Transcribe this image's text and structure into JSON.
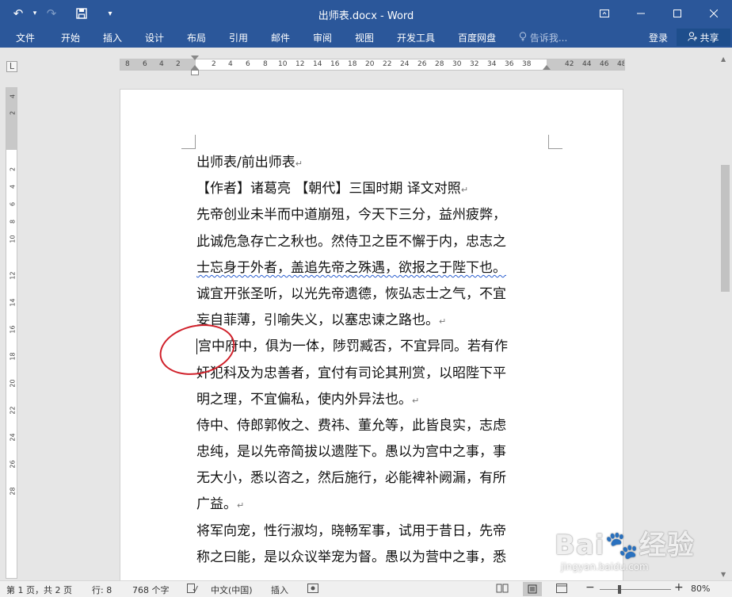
{
  "window": {
    "title": "出师表.docx - Word",
    "controls": [
      "ribbon-display-icon",
      "minimize-icon",
      "maximize-icon",
      "close-icon"
    ]
  },
  "qat": {
    "undo": "↶",
    "undo_drop": "▾",
    "redo": "↷",
    "save": "🖫",
    "customize": "▾"
  },
  "ribbon": {
    "tabs": [
      "文件",
      "开始",
      "插入",
      "设计",
      "布局",
      "引用",
      "邮件",
      "审阅",
      "视图",
      "开发工具",
      "百度网盘"
    ],
    "tellme": "告诉我...",
    "login": "登录",
    "share": "共享"
  },
  "ruler": {
    "corner": "L",
    "h_numbers": [
      "8",
      "6",
      "4",
      "2",
      "2",
      "4",
      "6",
      "8",
      "10",
      "12",
      "14",
      "16",
      "18",
      "20",
      "22",
      "24",
      "26",
      "28",
      "30",
      "32",
      "34",
      "36",
      "38",
      "42",
      "44",
      "46",
      "48"
    ],
    "v_numbers": [
      "4",
      "2",
      "2",
      "4",
      "6",
      "8",
      "10",
      "12",
      "14",
      "16",
      "18",
      "20",
      "22",
      "24",
      "26",
      "28"
    ]
  },
  "document": {
    "lines": [
      {
        "text": "出师表/前出师表",
        "mark": "↵"
      },
      {
        "text": "【作者】诸葛亮 【朝代】三国时期 译文对照",
        "mark": "↵"
      },
      {
        "text": "先帝创业未半而中道崩殂，今天下三分，益州疲弊，",
        "mark": ""
      },
      {
        "text": "此诚危急存亡之秋也。然侍卫之臣不懈于内，忠志之",
        "mark": ""
      },
      {
        "text": "士忘身于外者，盖追先帝之殊遇，欲报之于陛下也。",
        "mark": ""
      },
      {
        "text": "诚宜开张圣听，以光先帝遗德，恢弘志士之气，不宜",
        "mark": ""
      },
      {
        "text": "妄自菲薄，引喻失义，以塞忠谏之路也。",
        "mark": "↵"
      },
      {
        "text": "宫中府中，俱为一体，陟罚臧否，不宜异同。若有作",
        "mark": ""
      },
      {
        "text": "奸犯科及为忠善者，宜付有司论其刑赏，以昭陛下平",
        "mark": ""
      },
      {
        "text": "明之理，不宜偏私，使内外异法也。",
        "mark": "↵"
      },
      {
        "text": "侍中、侍郎郭攸之、费祎、董允等，此皆良实，志虑",
        "mark": ""
      },
      {
        "text": "忠纯，是以先帝简拔以遗陛下。愚以为宫中之事，事",
        "mark": ""
      },
      {
        "text": "无大小，悉以咨之，然后施行，必能裨补阙漏，有所",
        "mark": ""
      },
      {
        "text": "广益。",
        "mark": "↵"
      },
      {
        "text": "将军向宠，性行淑均，晓畅军事，试用于昔日，先帝",
        "mark": ""
      },
      {
        "text": "称之曰能，是以众议举宠为督。愚以为营中之事，悉",
        "mark": ""
      }
    ]
  },
  "status": {
    "page": "第 1 页，共 2 页",
    "line": "行: 8",
    "words": "768 个字",
    "language": "中文(中国)",
    "mode": "插入",
    "zoom_minus": "−",
    "zoom_plus": "+",
    "zoom": "80%"
  },
  "watermark": {
    "logo": "Bai🐾经验",
    "url": "jingyan.baidu.com"
  },
  "colors": {
    "titlebar": "#2b579a",
    "annotation": "#d0202a"
  }
}
